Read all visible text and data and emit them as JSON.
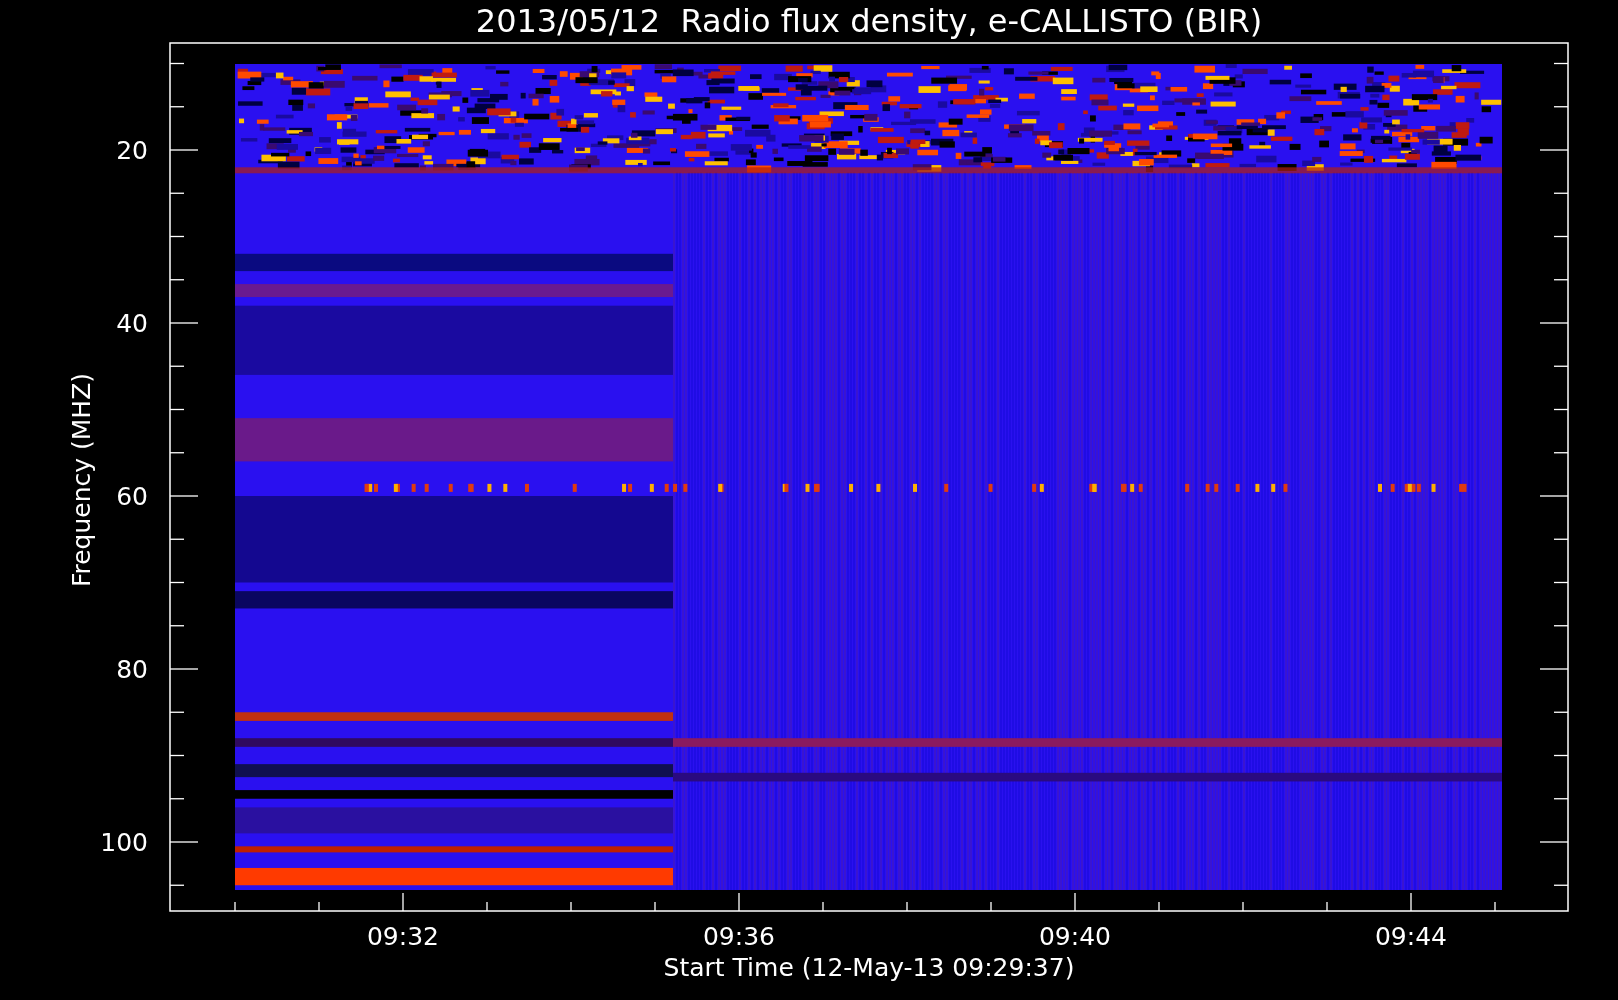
{
  "chart": {
    "title": "2013/05/12  Radio flux density, e-CALLISTO (BIR)",
    "ylabel": "Frequency (MHZ)",
    "xlabel": "Start Time (12-May-13 09:29:37)",
    "yticks": [
      "20",
      "40",
      "60",
      "80",
      "100"
    ],
    "xticks": [
      "09:32",
      "09:36",
      "09:40",
      "09:44"
    ]
  }
}
